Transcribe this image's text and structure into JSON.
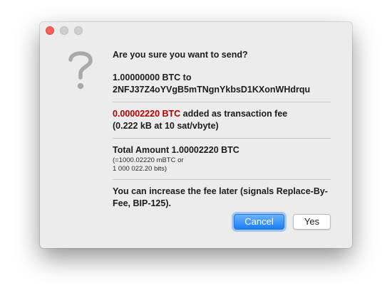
{
  "dialog": {
    "question": "Are you sure you want to send?",
    "amount_line": "1.00000000 BTC to",
    "address": "2NFJ37Z4oYVgB5mTNgnYkbsD1KXonWHdrqu",
    "fee_amount": "0.00002220 BTC",
    "fee_text": " added as transaction fee",
    "fee_detail": "(0.222 kB at 10 sat/vbyte)",
    "total_line": "Total Amount 1.00002220 BTC",
    "total_mbtc": "(=1000.02220 mBTC or",
    "total_bits": "1 000 022.20 bits)",
    "rbf_note": "You can increase the fee later (signals Replace-By-Fee, BIP-125).",
    "cancel_label": "Cancel",
    "yes_label": "Yes"
  },
  "colors": {
    "fee": "#b00000",
    "cancel_button": "#1a7ef7",
    "close_button": "#fc5f57"
  },
  "icons": [
    "close-icon",
    "minimize-icon",
    "maximize-icon",
    "question-mark-icon"
  ]
}
